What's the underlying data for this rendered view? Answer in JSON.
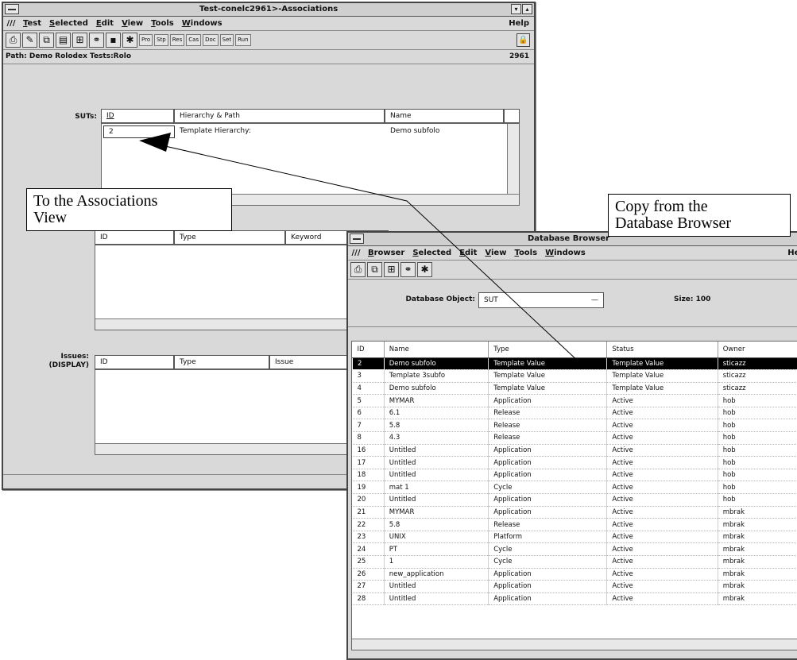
{
  "main_window": {
    "title": "Test-conelc2961>-Associations",
    "menu": [
      "Test",
      "Selected",
      "Edit",
      "View",
      "Tools",
      "Windows"
    ],
    "help": "Help",
    "toolbar_text_buttons": [
      "Pro",
      "Stp",
      "Res",
      "Cas",
      "Doc",
      "Set",
      "Run"
    ],
    "path": "Path: Demo Rolodex Tests:Rolo",
    "path_number": "2961",
    "suts": {
      "label": "SUTs:",
      "columns": [
        "ID",
        "Hierarchy & Path",
        "Name"
      ],
      "rows": [
        {
          "id": "2",
          "path": "Template Hierarchy:",
          "name": "Demo subfolo"
        }
      ]
    },
    "keywords": {
      "columns": [
        "ID",
        "Type",
        "Keyword"
      ]
    },
    "issues": {
      "label": "Issues:\n(DISPLAY)",
      "columns": [
        "ID",
        "Type",
        "Issue"
      ]
    }
  },
  "db_window": {
    "title": "Database Browser",
    "menu": [
      "Browser",
      "Selected",
      "Edit",
      "View",
      "Tools",
      "Windows"
    ],
    "help": "Help",
    "object_label": "Database Object:",
    "object_value": "SUT",
    "size_label": "Size: 100",
    "columns": [
      "ID",
      "Name",
      "Type",
      "Status",
      "Owner"
    ],
    "rows": [
      [
        "2",
        "Demo subfolo",
        "Template Value",
        "Template Value",
        "sticazz"
      ],
      [
        "3",
        "Template 3subfo",
        "Template Value",
        "Template Value",
        "sticazz"
      ],
      [
        "4",
        "Demo subfolo",
        "Template Value",
        "Template Value",
        "sticazz"
      ],
      [
        "5",
        "MYMAR",
        "Application",
        "Active",
        "hob"
      ],
      [
        "6",
        "6.1",
        "Release",
        "Active",
        "hob"
      ],
      [
        "7",
        "5.8",
        "Release",
        "Active",
        "hob"
      ],
      [
        "8",
        "4.3",
        "Release",
        "Active",
        "hob"
      ],
      [
        "16",
        "Untitled",
        "Application",
        "Active",
        "hob"
      ],
      [
        "17",
        "Untitled",
        "Application",
        "Active",
        "hob"
      ],
      [
        "18",
        "Untitled",
        "Application",
        "Active",
        "hob"
      ],
      [
        "19",
        "mat 1",
        "Cycle",
        "Active",
        "hob"
      ],
      [
        "20",
        "Untitled",
        "Application",
        "Active",
        "hob"
      ],
      [
        "21",
        "MYMAR",
        "Application",
        "Active",
        "mbrak"
      ],
      [
        "22",
        "5.8",
        "Release",
        "Active",
        "mbrak"
      ],
      [
        "23",
        "UNIX",
        "Platform",
        "Active",
        "mbrak"
      ],
      [
        "24",
        "PT",
        "Cycle",
        "Active",
        "mbrak"
      ],
      [
        "25",
        "1",
        "Cycle",
        "Active",
        "mbrak"
      ],
      [
        "26",
        "new_application",
        "Application",
        "Active",
        "mbrak"
      ],
      [
        "27",
        "Untitled",
        "Application",
        "Active",
        "mbrak"
      ],
      [
        "28",
        "Untitled",
        "Application",
        "Active",
        "mbrak"
      ]
    ]
  },
  "callouts": {
    "associations": "To the Associations\nView",
    "database": "Copy from the\nDatabase Browser"
  },
  "icons": [
    "system-menu-icon",
    "minimize-icon",
    "maximize-icon",
    "lock-icon",
    "print-icon",
    "copy-icon",
    "save-icon"
  ]
}
